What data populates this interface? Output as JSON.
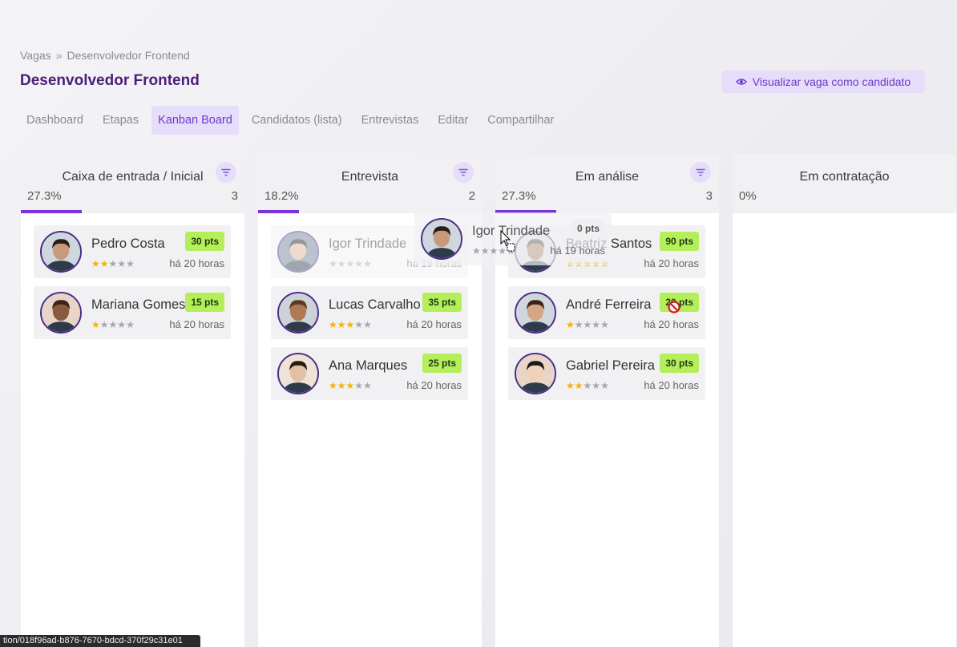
{
  "breadcrumb": {
    "parent": "Vagas",
    "separator": "»",
    "current": "Desenvolvedor Frontend"
  },
  "page": {
    "title": "Desenvolvedor Frontend",
    "preview_label": "Visualizar vaga como candidato"
  },
  "tabs": [
    {
      "label": "Dashboard"
    },
    {
      "label": "Etapas"
    },
    {
      "label": "Kanban Board",
      "active": true
    },
    {
      "label": "Candidatos (lista)"
    },
    {
      "label": "Entrevistas"
    },
    {
      "label": "Editar"
    },
    {
      "label": "Compartilhar"
    }
  ],
  "columns": [
    {
      "title": "Caixa de entrada / Inicial",
      "percent": "27.3%",
      "count": "3",
      "progress": 0.273,
      "filter": true,
      "cards": [
        {
          "name": "Pedro Costa",
          "pts": "30 pts",
          "stars": 2,
          "time": "há 20 horas"
        },
        {
          "name": "Mariana Gomes",
          "pts": "15 pts",
          "stars": 1,
          "time": "há 20 horas"
        }
      ]
    },
    {
      "title": "Entrevista",
      "percent": "18.2%",
      "count": "2",
      "progress": 0.182,
      "filter": true,
      "cards": [
        {
          "name": "Igor Trindade",
          "pts": "0 pts",
          "stars": 0,
          "time": "há 19 horas",
          "ghost": true
        },
        {
          "name": "Lucas Carvalho",
          "pts": "35 pts",
          "stars": 3,
          "time": "há 20 horas"
        },
        {
          "name": "Ana Marques",
          "pts": "25 pts",
          "stars": 3,
          "time": "há 20 horas"
        }
      ]
    },
    {
      "title": "Em análise",
      "percent": "27.3%",
      "count": "3",
      "progress": 0.273,
      "filter": true,
      "cards": [
        {
          "name": "Beatriz Santos",
          "pts": "90 pts",
          "stars": 5,
          "time": "há 20 horas"
        },
        {
          "name": "André Ferreira",
          "pts": "20 pts",
          "stars": 1,
          "time": "há 20 horas"
        },
        {
          "name": "Gabriel Pereira",
          "pts": "30 pts",
          "stars": 2,
          "time": "há 20 horas"
        }
      ]
    },
    {
      "title": "Em contratação",
      "percent": "0%",
      "count": "",
      "progress": 0,
      "filter": false,
      "cards": []
    }
  ],
  "dragging": {
    "name": "Igor Trindade",
    "pts": "0 pts",
    "stars": 0,
    "time": "há 19 horas"
  },
  "status_url": "tion/018f96ad-b876-7670-bdcd-370f29c31e01",
  "colors": {
    "accent": "#7a33d8",
    "accent_soft": "#e6ddfb",
    "title": "#4a1e7a",
    "pts_bg": "#b5ee5b"
  },
  "icons": {
    "preview": "eye-icon",
    "filter": "filter-icon",
    "star": "star-icon",
    "cursor": "drag-cursor-icon",
    "no_drop": "no-drop-icon"
  }
}
